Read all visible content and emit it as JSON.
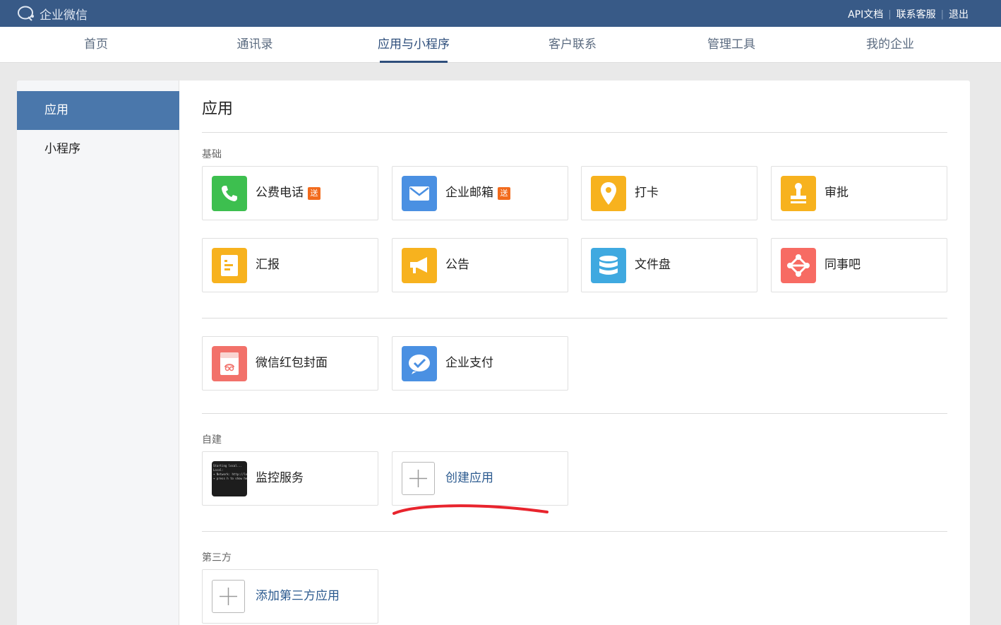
{
  "app": {
    "title": "企业微信"
  },
  "topbar": {
    "links": [
      "API文档",
      "联系客服",
      "退出"
    ]
  },
  "nav": {
    "items": [
      "首页",
      "通讯录",
      "应用与小程序",
      "客户联系",
      "管理工具",
      "我的企业"
    ],
    "active_index": 2
  },
  "sidebar": {
    "items": [
      "应用",
      "小程序"
    ],
    "active_index": 0
  },
  "main": {
    "title": "应用",
    "sections": {
      "basic": {
        "label": "基础"
      },
      "custom": {
        "label": "自建"
      },
      "third": {
        "label": "第三方"
      }
    },
    "basic_apps": [
      {
        "label": "公费电话",
        "badge": "送",
        "icon": "phone-icon",
        "color": "#3dbf4f"
      },
      {
        "label": "企业邮箱",
        "badge": "送",
        "icon": "mail-icon",
        "color": "#4a90e2"
      },
      {
        "label": "打卡",
        "icon": "location-pin-icon",
        "color": "#f7b21e"
      },
      {
        "label": "审批",
        "icon": "stamp-icon",
        "color": "#f7b21e"
      },
      {
        "label": "汇报",
        "icon": "report-icon",
        "color": "#f7b21e"
      },
      {
        "label": "公告",
        "icon": "megaphone-icon",
        "color": "#f7b21e"
      },
      {
        "label": "文件盘",
        "icon": "database-icon",
        "color": "#3fa9e0"
      },
      {
        "label": "同事吧",
        "icon": "network-icon",
        "color": "#f76b63"
      }
    ],
    "extra_apps": [
      {
        "label": "微信红包封面",
        "icon": "red-packet-icon",
        "color": "#f2716a"
      },
      {
        "label": "企业支付",
        "icon": "pay-icon",
        "color": "#4a90e2"
      }
    ],
    "custom_apps": [
      {
        "label": "监控服务",
        "icon": "terminal-icon",
        "color": "#1d1d1d",
        "thumb_lines": [
          "Starting local...",
          "  Local:",
          "  ➜  Network: http://localhost",
          "  ➜  press h to show help"
        ]
      }
    ],
    "create_app": {
      "label": "创建应用"
    },
    "add_third": {
      "label": "添加第三方应用"
    }
  },
  "annotation": {
    "color": "#e8242d"
  }
}
